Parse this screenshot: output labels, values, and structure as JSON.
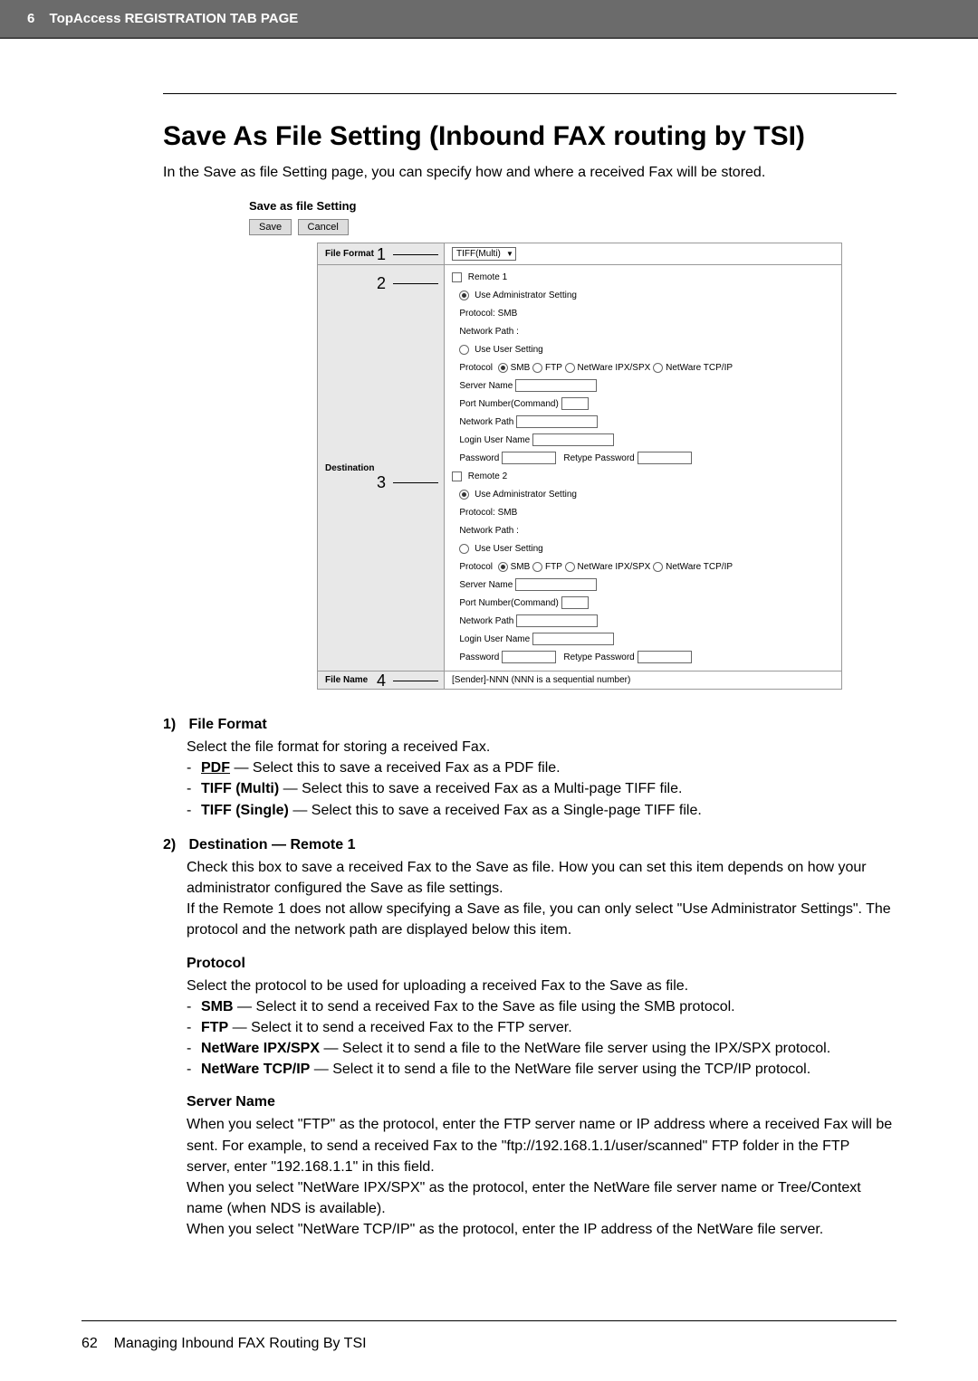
{
  "header": {
    "chapter": "6",
    "title": "TopAccess REGISTRATION TAB PAGE"
  },
  "main": {
    "title": "Save As File Setting (Inbound FAX routing by TSI)",
    "intro": "In the Save as file Setting page, you can specify how and where a received Fax will be stored."
  },
  "screenshot": {
    "heading": "Save as file Setting",
    "buttons": {
      "save": "Save",
      "cancel": "Cancel"
    },
    "callouts": {
      "c1": "1",
      "c2": "2",
      "c3": "3",
      "c4": "4"
    },
    "rows": {
      "file_format": {
        "label": "File Format",
        "value": "TIFF(Multi)"
      },
      "destination": {
        "label": "Destination",
        "remote1": {
          "title": "Remote 1",
          "use_admin": "Use Administrator Setting",
          "protocol_label": "Protocol: SMB",
          "network_path_ro": "Network Path :",
          "use_user": "Use User Setting",
          "protocol_opts": {
            "lead": "Protocol",
            "smb": "SMB",
            "ftp": "FTP",
            "ipx": "NetWare IPX/SPX",
            "tcp": "NetWare TCP/IP"
          },
          "server_name": "Server Name",
          "port": "Port Number(Command)",
          "network_path": "Network Path",
          "login": "Login User Name",
          "password": "Password",
          "retype": "Retype Password"
        },
        "remote2": {
          "title": "Remote 2"
        }
      },
      "file_name": {
        "label": "File Name",
        "value": "[Sender]-NNN (NNN is a sequential number)"
      }
    }
  },
  "items": {
    "i1": {
      "num": "1)",
      "title": "File Format",
      "intro": "Select the file format for storing a received Fax.",
      "pdf": "PDF",
      "pdf_desc": " — Select this to save a received Fax as a PDF file.",
      "tiff_multi": "TIFF (Multi)",
      "tiff_multi_desc": " — Select this to save a received Fax as a Multi-page TIFF file.",
      "tiff_single": "TIFF (Single)",
      "tiff_single_desc": " — Select this to save a received Fax as a Single-page TIFF file."
    },
    "i2": {
      "num": "2)",
      "title": "Destination — Remote 1",
      "p1": "Check this box to save a received Fax to the Save as file. How you can set this item depends on how your administrator configured the Save as file settings.",
      "p2": "If the Remote 1 does not allow specifying a Save as file, you can only select \"Use Administrator Settings\". The protocol and the network path are displayed below this item."
    },
    "protocol": {
      "heading": "Protocol",
      "intro": "Select the protocol to be used for uploading a received Fax to the Save as file.",
      "smb": "SMB",
      "smb_desc": " — Select it to send a received Fax to the Save as file using the SMB protocol.",
      "ftp": "FTP",
      "ftp_desc": " — Select it to send a received Fax to the FTP server.",
      "ipx": "NetWare IPX/SPX",
      "ipx_desc": " — Select it to send a file to the NetWare file server using the IPX/SPX protocol.",
      "tcp": "NetWare TCP/IP",
      "tcp_desc": " — Select it to send a file to the NetWare file server using the TCP/IP protocol."
    },
    "server_name": {
      "heading": "Server Name",
      "p1": "When you select \"FTP\" as the protocol, enter the FTP server name or IP address where a received Fax will be sent. For example, to send a received Fax to the \"ftp://192.168.1.1/user/scanned\" FTP folder in the FTP server, enter \"192.168.1.1\" in this field.",
      "p2": "When you select \"NetWare IPX/SPX\" as the protocol, enter the NetWare file server name or Tree/Context name (when NDS is available).",
      "p3": "When you select \"NetWare TCP/IP\" as the protocol, enter the IP address of the NetWare file server."
    }
  },
  "footer": {
    "page": "62",
    "section": "Managing Inbound FAX Routing By TSI"
  }
}
